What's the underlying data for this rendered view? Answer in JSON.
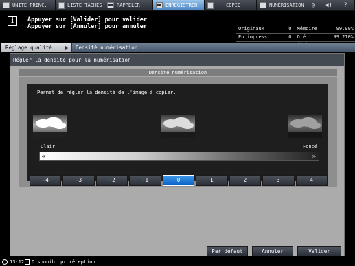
{
  "tabs": [
    {
      "label": "UNITE PRINC.",
      "icon": "machine-icon"
    },
    {
      "label": "LISTE TÂCHES",
      "icon": "job-list-icon"
    },
    {
      "label": "RAPPELER",
      "icon": "recall-icon"
    },
    {
      "label": "ENREGISTRER",
      "icon": "register-icon"
    },
    {
      "label": "COPIE",
      "icon": "copy-icon"
    },
    {
      "label": "NUMÉRISATION",
      "icon": "scan-icon"
    }
  ],
  "message": {
    "line1": "Appuyer sur [Valider] pour valider",
    "line2": "Appuyer sur [Annuler] pour annuler"
  },
  "counters": {
    "originaux_label": "Originaux",
    "originaux_value": "0",
    "memoire_label": "Mémoire",
    "memoire_value": "99.99%",
    "impress_label": "En impress.",
    "impress_value": "0",
    "fichier_label": "Qté fichier",
    "fichier_value": "99.210%"
  },
  "breadcrumb": {
    "parent": "Réglage qualité",
    "current": "Densité numérisation"
  },
  "panel": {
    "title": "Régler la densité pour la numérisation",
    "subtitle": "Densité numérisation",
    "description": "Permet de régler la densité de l'image à copier.",
    "light_label": "Clair",
    "dark_label": "Foncé"
  },
  "levels": {
    "options": [
      "-4",
      "-3",
      "-2",
      "-1",
      "0",
      "1",
      "2",
      "3",
      "4"
    ],
    "selected": "0"
  },
  "buttons": {
    "default": "Par défaut",
    "cancel": "Annuler",
    "validate": "Valider"
  },
  "status": {
    "time": "13:12",
    "reception": "Disponib. pr réception"
  },
  "colors": {
    "selected_level": "#0a64c8",
    "active_tab": "#4a86c2"
  }
}
